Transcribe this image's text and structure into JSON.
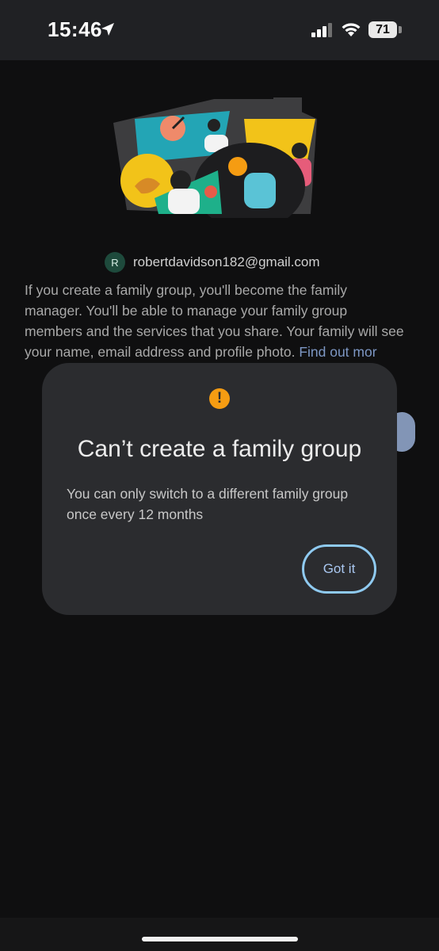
{
  "status_bar": {
    "time": "15:46",
    "battery_level": "71",
    "icons": [
      "location-arrow-icon",
      "cellular-signal-icon",
      "wifi-icon",
      "battery-icon"
    ]
  },
  "account": {
    "avatar_initial": "R",
    "email": "robertdavidson182@gmail.com"
  },
  "description": {
    "text": "If you create a family group, you'll become the family manager. You'll be able to manage your family group members and the services that you share. Your family will see your name, email address and profile photo. ",
    "link": "Find out mor"
  },
  "dialog": {
    "icon": "exclamation-alert-icon",
    "title": "Can’t create a family group",
    "body": "You can only switch to a different family group once every 12 months",
    "button_label": "Got it"
  },
  "colors": {
    "background": "#0f0f10",
    "dialog": "#2b2c2f",
    "alert": "#f59c12",
    "button_outline": "#8fcaf0",
    "link": "#7d97c4"
  }
}
